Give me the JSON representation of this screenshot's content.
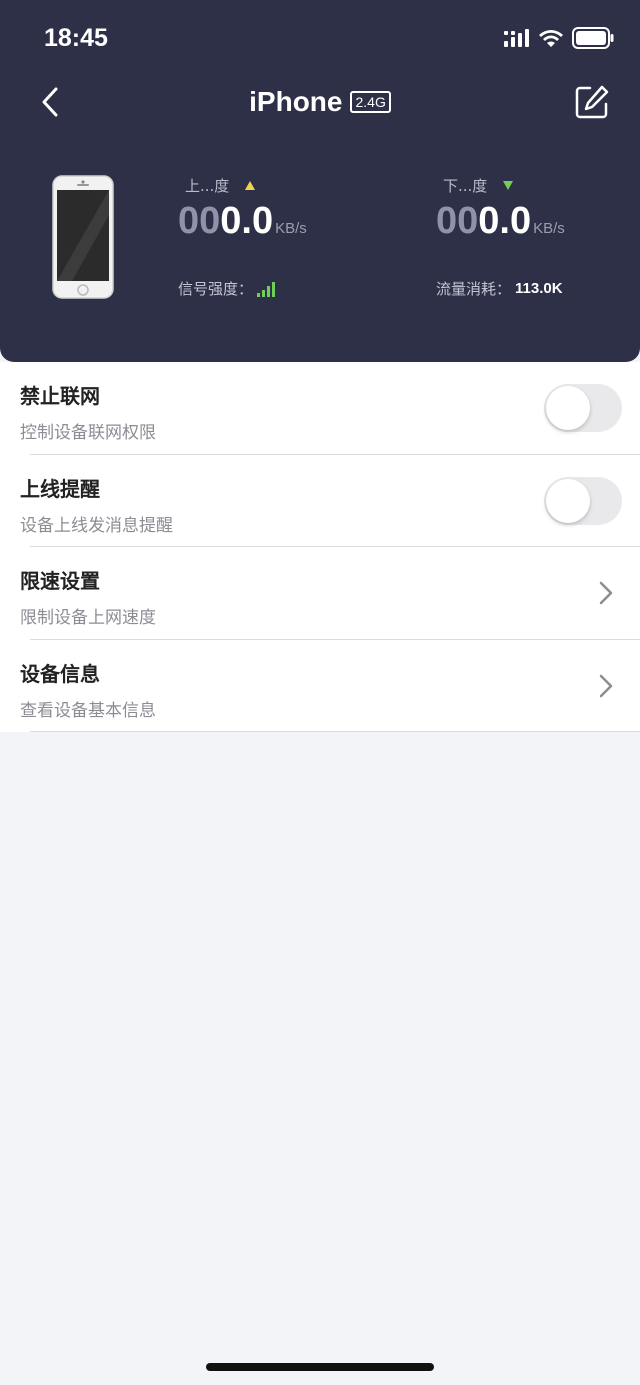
{
  "status_bar": {
    "time": "18:45"
  },
  "nav": {
    "title": "iPhone",
    "band": "2.4G"
  },
  "stats": {
    "upload": {
      "label": "上...度",
      "value_dim": "00",
      "value_bright": "0.0",
      "unit": "KB/s",
      "arrow_color": "#f2d34c"
    },
    "download": {
      "label": "下...度",
      "value_dim": "00",
      "value_bright": "0.0",
      "unit": "KB/s",
      "arrow_color": "#6fcf5a"
    },
    "signal": {
      "label": "信号强度：",
      "icon": "signal-bars-icon"
    },
    "traffic": {
      "label": "流量消耗：",
      "value": "113.0K"
    }
  },
  "settings": [
    {
      "title": "禁止联网",
      "subtitle": "控制设备联网权限",
      "control": "toggle",
      "on": false
    },
    {
      "title": "上线提醒",
      "subtitle": "设备上线发消息提醒",
      "control": "toggle",
      "on": false
    },
    {
      "title": "限速设置",
      "subtitle": "限制设备上网速度",
      "control": "chevron"
    },
    {
      "title": "设备信息",
      "subtitle": "查看设备基本信息",
      "control": "chevron"
    }
  ],
  "colors": {
    "header_bg": "#2e3047",
    "page_bg": "#f3f4f8",
    "signal_green": "#6fcf5a"
  }
}
